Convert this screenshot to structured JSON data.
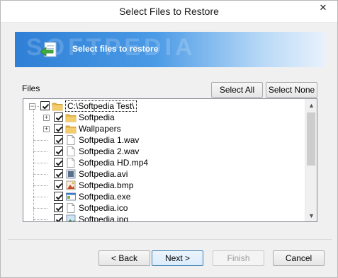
{
  "window": {
    "title": "Select Files to Restore",
    "close_glyph": "✕"
  },
  "banner": {
    "watermark": "SOFTPEDIA",
    "text": "Select files to restore",
    "icon": "restore-arrow-icon"
  },
  "files_label": "Files",
  "buttons": {
    "select_all": "Select All",
    "select_none": "Select None",
    "back": "< Back",
    "next": "Next >",
    "finish": "Finish",
    "cancel": "Cancel"
  },
  "tree": {
    "items": [
      {
        "label": "C:\\Softpedia Test\\",
        "icon": "folder-icon",
        "checked": true,
        "expander": "−",
        "selected": true
      },
      {
        "label": "Softpedia",
        "icon": "folder-icon",
        "checked": true,
        "expander": "+"
      },
      {
        "label": "Wallpapers",
        "icon": "folder-icon",
        "checked": true,
        "expander": "+"
      },
      {
        "label": "Softpedia 1.wav",
        "icon": "file-icon",
        "checked": true
      },
      {
        "label": "Softpedia 2.wav",
        "icon": "file-icon",
        "checked": true
      },
      {
        "label": "Softpedia HD.mp4",
        "icon": "file-icon",
        "checked": true
      },
      {
        "label": "Softpedia.avi",
        "icon": "video-file-icon",
        "checked": true
      },
      {
        "label": "Softpedia.bmp",
        "icon": "image-file-icon",
        "checked": true
      },
      {
        "label": "Softpedia.exe",
        "icon": "exe-file-icon",
        "checked": true
      },
      {
        "label": "Softpedia.ico",
        "icon": "file-icon",
        "checked": true
      },
      {
        "label": "Softpedia.jpg",
        "icon": "jpg-file-icon",
        "checked": true
      }
    ]
  },
  "colors": {
    "banner_start": "#2e7fd6",
    "folder": "#e8b84a",
    "check": "#1a1a1a"
  }
}
